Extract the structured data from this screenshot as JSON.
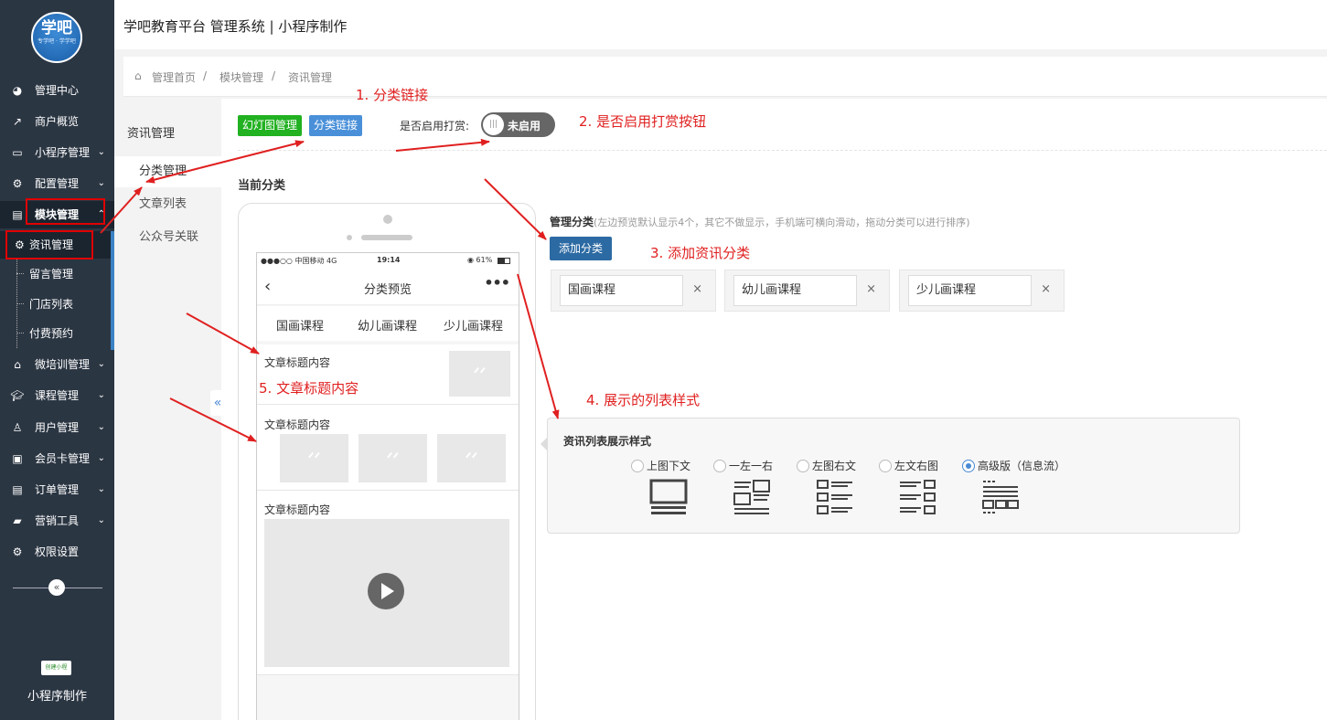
{
  "app": {
    "title": "学吧教育平台 管理系统 | 小程序制作",
    "logo_text": "学吧",
    "logo_sub": "专学吧 · 学学吧",
    "footer_label": "小程序制作",
    "mini_logo": "创建小程"
  },
  "sidebar": {
    "items": [
      {
        "label": "管理中心",
        "icon": "dashboard-icon"
      },
      {
        "label": "商户概览",
        "icon": "chart-icon"
      },
      {
        "label": "小程序管理",
        "icon": "monitor-icon"
      },
      {
        "label": "配置管理",
        "icon": "gears-icon"
      },
      {
        "label": "模块管理",
        "icon": "module-icon"
      },
      {
        "label": "微培训管理",
        "icon": "home-icon"
      },
      {
        "label": "课程管理",
        "icon": "graduation-cap-icon"
      },
      {
        "label": "用户管理",
        "icon": "user-icon"
      },
      {
        "label": "会员卡管理",
        "icon": "card-icon"
      },
      {
        "label": "订单管理",
        "icon": "order-icon"
      },
      {
        "label": "营销工具",
        "icon": "briefcase-icon"
      },
      {
        "label": "权限设置",
        "icon": "gear-icon"
      }
    ],
    "sub_items": [
      {
        "label": "资讯管理",
        "icon": "gear-icon"
      },
      {
        "label": "留言管理"
      },
      {
        "label": "门店列表"
      },
      {
        "label": "付费预约"
      }
    ],
    "collapse_icon": "«"
  },
  "breadcrumb": [
    "管理首页",
    "模块管理",
    "资讯管理"
  ],
  "subnav": {
    "title": "资讯管理",
    "items": [
      "分类管理",
      "文章列表",
      "公众号关联"
    ],
    "toggle": "«"
  },
  "toolbar": {
    "slide_btn": "幻灯图管理",
    "category_link_btn": "分类链接",
    "reward_label": "是否启用打赏:",
    "reward_toggle": "未启用",
    "reward_knob": "|||"
  },
  "current_category": "当前分类",
  "phone": {
    "carrier": "●●●○○ 中国移动  4G",
    "time": "19:14",
    "battery": "◉ 61%",
    "back": "‹",
    "title": "分类预览",
    "more": "•••",
    "tabs": [
      "国画课程",
      "幼儿画课程",
      "少儿画课程"
    ],
    "articles": [
      "文章标题内容",
      "文章标题内容",
      "文章标题内容"
    ],
    "placeholder": "ᐟᐟ"
  },
  "manage": {
    "title": "管理分类",
    "hint": "(左边预览默认显示4个，其它不做显示，手机端可横向滑动，拖动分类可以进行排序)",
    "add_btn": "添加分类",
    "categories": [
      "国画课程",
      "幼儿画课程",
      "少儿画课程"
    ],
    "remove": "×"
  },
  "list_style": {
    "title": "资讯列表展示样式",
    "options": [
      "上图下文",
      "一左一右",
      "左图右文",
      "左文右图",
      "高级版（信息流）"
    ],
    "selected": "高级版（信息流）"
  },
  "annotations": {
    "a1": "1. 分类链接",
    "a2": "2. 是否启用打赏按钮",
    "a3": "3. 添加资讯分类",
    "a4": "4. 展示的列表样式",
    "a5": "5. 文章标题内容"
  },
  "colors": {
    "sidebar_bg": "#2b3643",
    "annotation": "#e02020",
    "accent_blue": "#2c6aa3",
    "green": "#21b121"
  }
}
